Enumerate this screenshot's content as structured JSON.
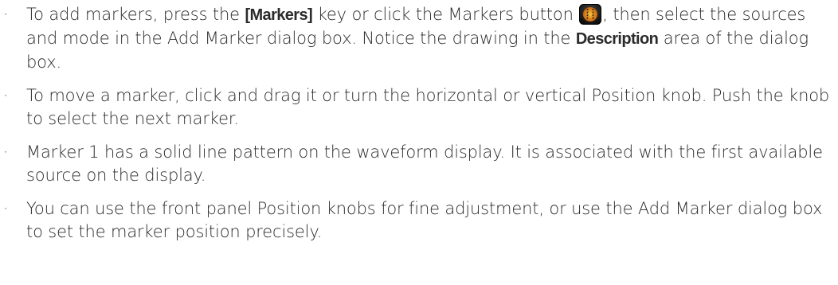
{
  "items": [
    {
      "t1": "To add markers, press the ",
      "key": "[Markers]",
      "t2": " key or click the Markers button ",
      "icon": "markers-button-icon",
      "t3": ", then select the sources and mode in the Add Marker dialog box. Notice the drawing in the ",
      "bold": "Description",
      "t4": " area of the dialog box."
    },
    {
      "text": "To move a marker, click and drag it or turn the horizontal or vertical Position knob. Push the knob to select the next marker."
    },
    {
      "text": "Marker 1 has a solid line pattern on the waveform display. It is associated with the first available source on the display."
    },
    {
      "text": "You can use the front panel Position knobs for fine adjustment, or use the Add Marker dialog box to set the marker position precisely."
    }
  ],
  "bullet_char": "·",
  "colors": {
    "text": "#2b2b2b",
    "button_bg": "#1a1a1a",
    "marker_orange": "#e88a1a",
    "marker_yellow": "#f4d23a"
  }
}
